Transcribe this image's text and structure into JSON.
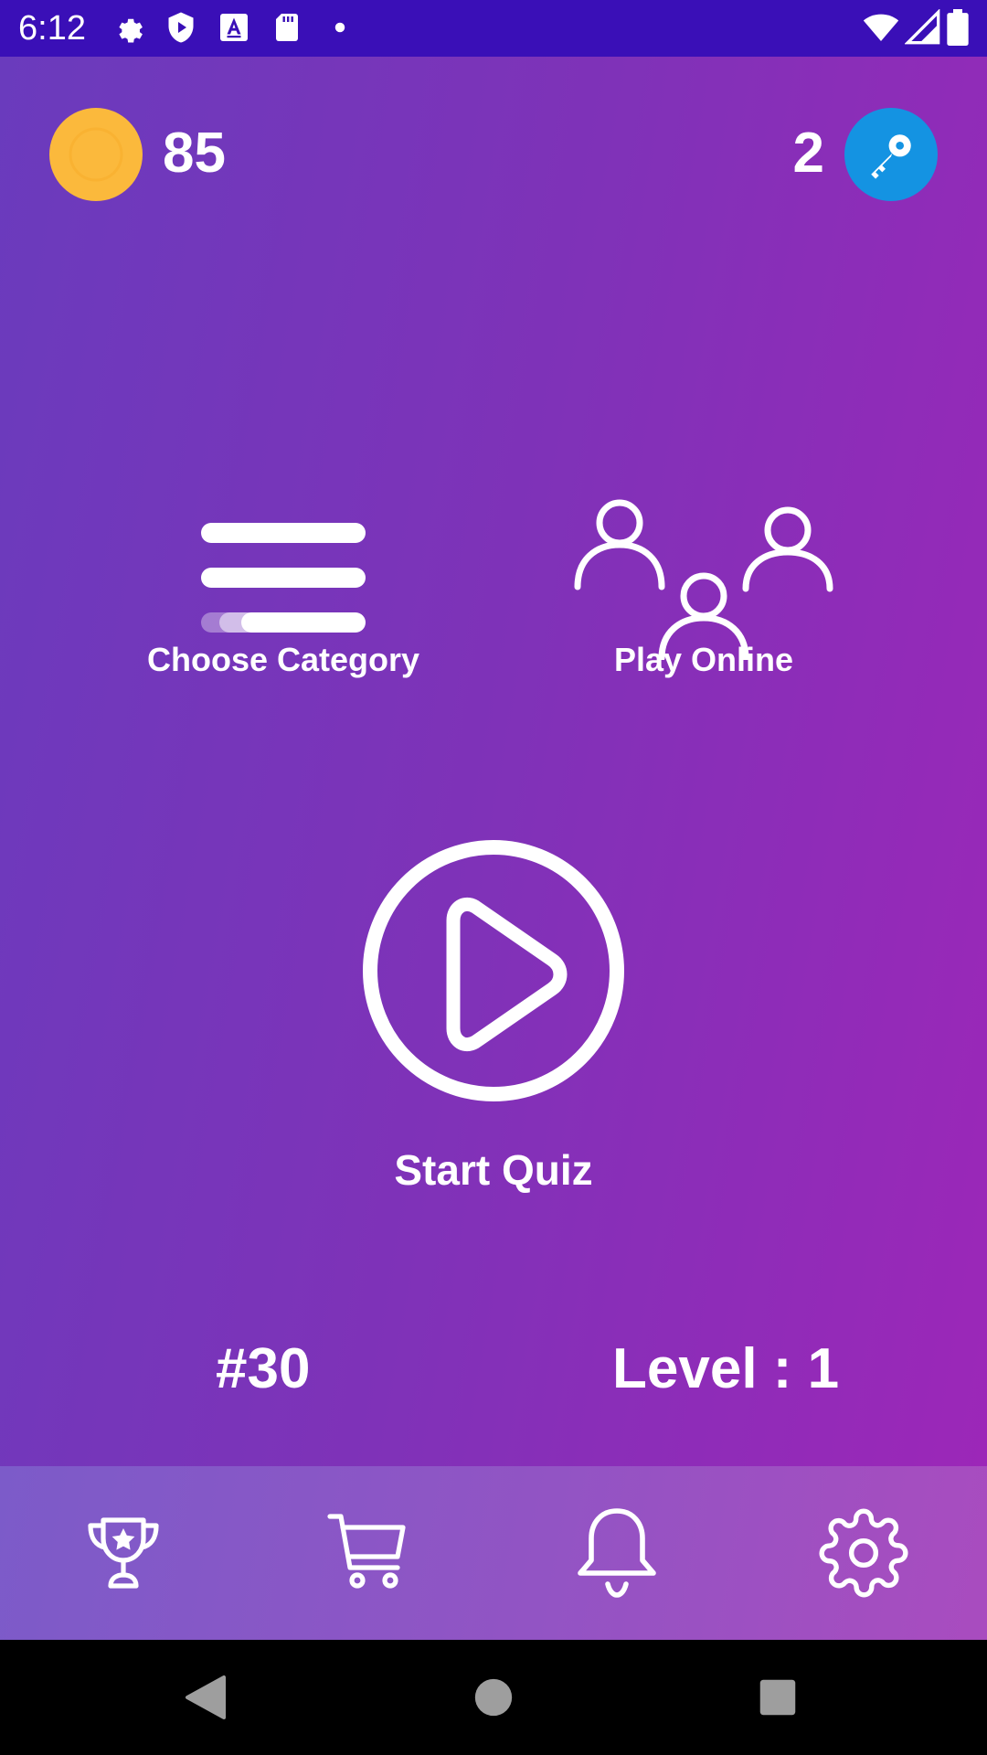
{
  "status_bar": {
    "time": "6:12",
    "icons": [
      "gear-icon",
      "shield-play-icon",
      "font-a-icon",
      "sd-card-icon",
      "dot-icon",
      "wifi-icon",
      "signal-icon",
      "battery-icon"
    ]
  },
  "header": {
    "coin_count": "85",
    "key_count": "2",
    "coin_color": "#fbb93c",
    "key_color": "#1493e2"
  },
  "menu": {
    "choose_category": "Choose Category",
    "play_online": "Play Online",
    "start_quiz": "Start Quiz"
  },
  "stats": {
    "rank": "#30",
    "level": "Level : 1"
  },
  "bottom_nav": {
    "icons": [
      "trophy-icon",
      "cart-icon",
      "bell-icon",
      "settings-icon"
    ]
  },
  "colors": {
    "status_bar": "#3a0fb7",
    "gradient_start": "#6a3bbd",
    "gradient_end": "#9c27b8"
  }
}
